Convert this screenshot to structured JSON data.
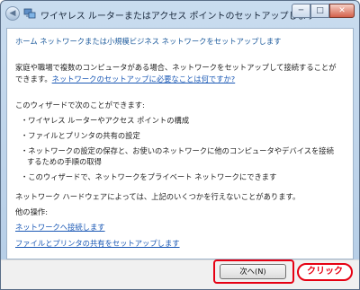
{
  "window": {
    "title": "ワイヤレス ルーターまたはアクセス ポイントのセットアップします",
    "back_glyph": "◀",
    "min_glyph": "─",
    "max_glyph": "□",
    "close_glyph": "✕"
  },
  "wizard": {
    "heading": "ホーム ネットワークまたは小規模ビジネス ネットワークをセットアップします",
    "intro_line1": "家庭や職場で複数のコンピュータがある場合、ネットワークをセットアップして接続することが",
    "intro_line2_prefix": "できます。",
    "intro_link": "ネットワークのセットアップに必要なことは何ですか?",
    "can_do_title": "このウィザードで次のことができます:",
    "items": [
      "・ワイヤレス ルーターやアクセス ポイントの構成",
      "・ファイルとプリンタの共有の設定",
      "・ネットワークの設定の保存と、お使いのネットワークに他のコンピュータやデバイスを接続",
      "するための手順の取得",
      "・このウィザードで、ネットワークをプライベート ネットワークにできます"
    ],
    "note": "ネットワーク ハードウェアによっては、上記のいくつかを行えないことがあります。",
    "other_title": "他の操作:",
    "other_links": [
      "ネットワークへ接続します",
      "ファイルとプリンタの共有をセットアップします"
    ]
  },
  "footer": {
    "next_label": "次へ(N)",
    "callout_label": "クリック",
    "highlight_color": "#e60012"
  }
}
